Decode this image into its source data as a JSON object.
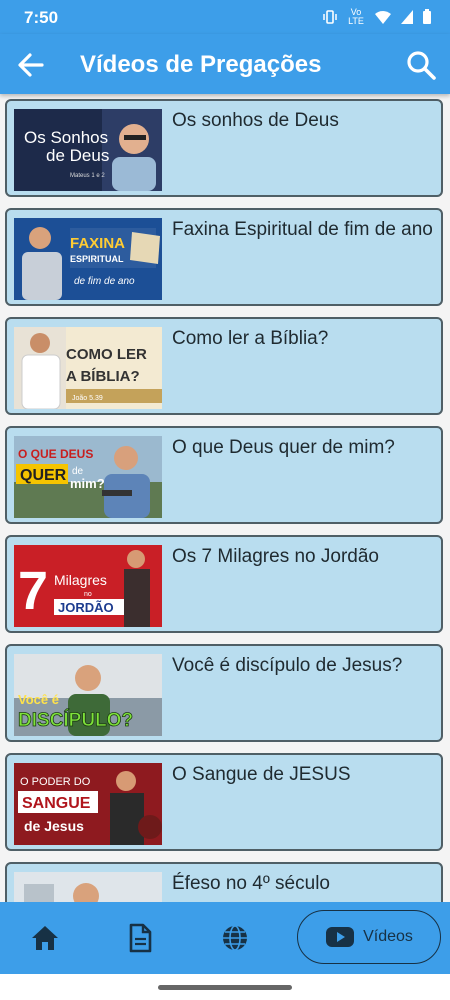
{
  "status": {
    "time": "7:50",
    "network_label": "Vo LTE"
  },
  "app_bar": {
    "title": "Vídeos de Pregações"
  },
  "videos": [
    {
      "title": "Os sonhos de Deus",
      "thumb_text": [
        "Os Sonhos",
        "de Deus",
        "Mateus 1 e 2"
      ]
    },
    {
      "title": "Faxina Espiritual de fim de ano",
      "thumb_text": [
        "FAXINA",
        "ESPIRITUAL",
        "de fim de ano"
      ]
    },
    {
      "title": "Como ler a Bíblia?",
      "thumb_text": [
        "COMO LER",
        "A BÍBLIA?",
        "João 5.39"
      ]
    },
    {
      "title": "O que Deus quer de mim?",
      "thumb_text": [
        "O QUE DEUS",
        "QUER",
        "de",
        "mim?"
      ]
    },
    {
      "title": "Os 7 Milagres no Jordão",
      "thumb_text": [
        "7",
        "Milagres",
        "no",
        "JORDÃO"
      ]
    },
    {
      "title": "Você é discípulo de Jesus?",
      "thumb_text": [
        "Você é",
        "DISCÍPULO?"
      ]
    },
    {
      "title": "O Sangue de JESUS",
      "thumb_text": [
        "O PODER DO",
        "SANGUE",
        "de Jesus"
      ]
    },
    {
      "title": "Éfeso no 4º século",
      "thumb_text": []
    }
  ],
  "bottom_nav": {
    "items": [
      {
        "icon": "home-icon"
      },
      {
        "icon": "document-icon"
      },
      {
        "icon": "globe-icon"
      },
      {
        "icon": "youtube-icon",
        "label": "Vídeos",
        "active": true
      }
    ]
  },
  "colors": {
    "primary": "#3d9ee9",
    "card_background": "#b9ddef",
    "active_nav_text": "#173145"
  }
}
